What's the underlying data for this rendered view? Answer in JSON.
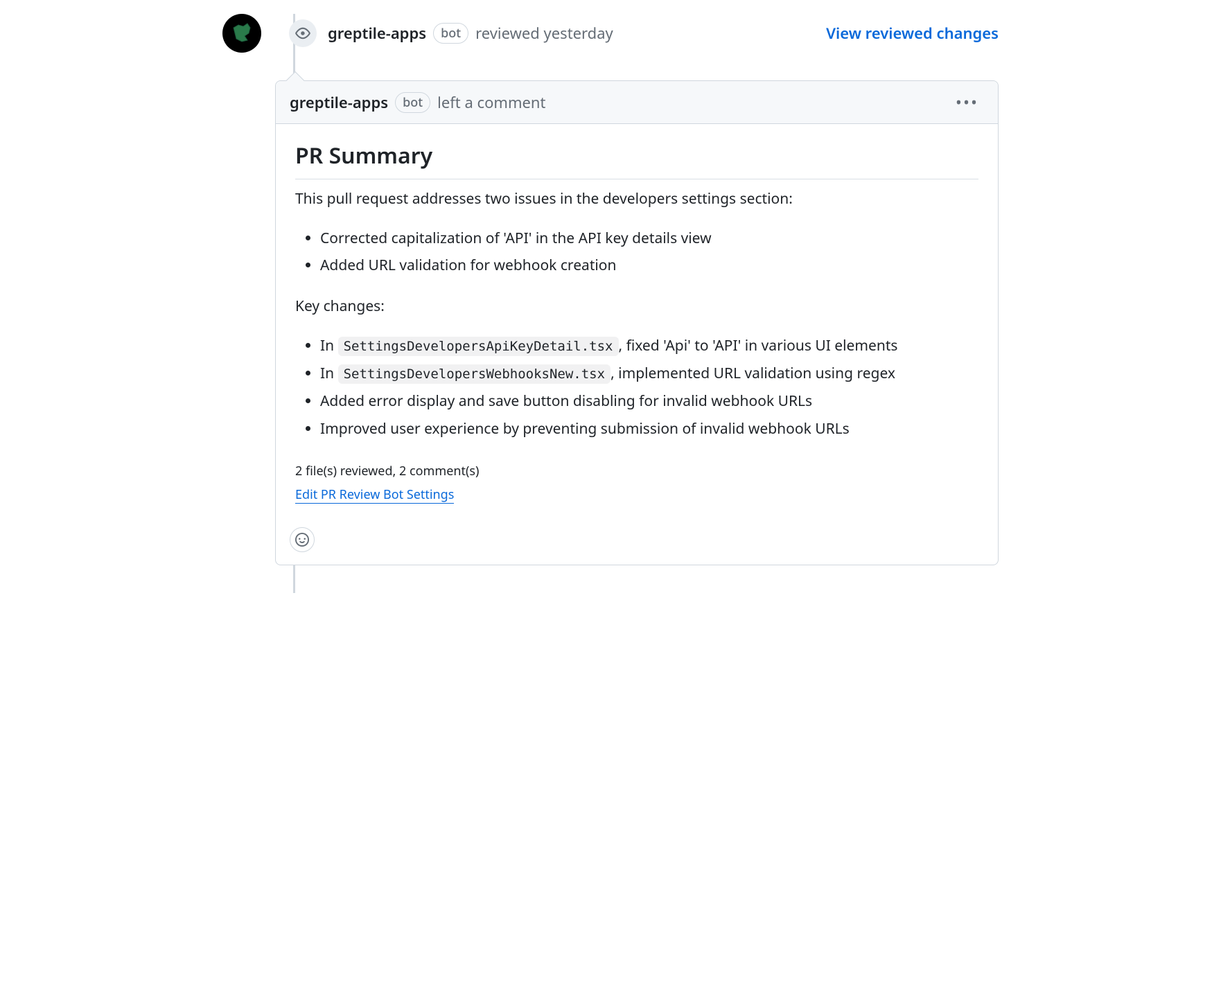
{
  "timeline": {
    "author": "greptile-apps",
    "bot_label": "bot",
    "action_text": "reviewed yesterday",
    "view_changes": "View reviewed changes"
  },
  "comment_header": {
    "author": "greptile-apps",
    "bot_label": "bot",
    "action_text": "left a comment"
  },
  "comment": {
    "title": "PR Summary",
    "intro": "This pull request addresses two issues in the developers settings section:",
    "bullets1": [
      "Corrected capitalization of 'API' in the API key details view",
      "Added URL validation for webhook creation"
    ],
    "key_changes_label": "Key changes:",
    "bullets2": {
      "item1_prefix": "In ",
      "item1_code": "SettingsDevelopersApiKeyDetail.tsx",
      "item1_suffix": ", fixed 'Api' to 'API' in various UI elements",
      "item2_prefix": "In ",
      "item2_code": "SettingsDevelopersWebhooksNew.tsx",
      "item2_suffix": ", implemented URL validation using regex",
      "item3": "Added error display and save button disabling for invalid webhook URLs",
      "item4": "Improved user experience by preventing submission of invalid webhook URLs"
    },
    "review_stats": "2 file(s) reviewed, 2 comment(s)",
    "edit_settings": "Edit PR Review Bot Settings"
  }
}
